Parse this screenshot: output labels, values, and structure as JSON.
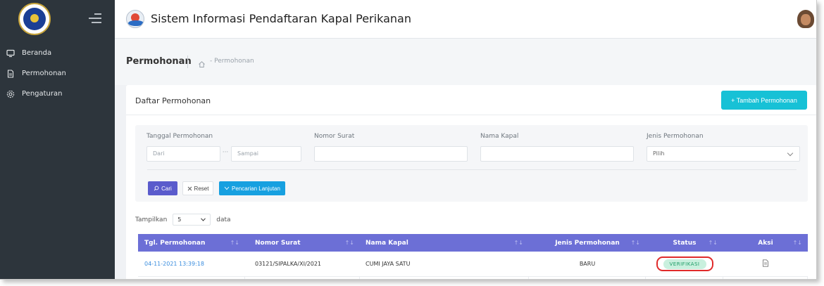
{
  "app": {
    "title": "Sistem Informasi Pendaftaran Kapal Perikanan"
  },
  "sidebar": {
    "items": [
      {
        "label": "Beranda",
        "icon": "monitor-icon"
      },
      {
        "label": "Permohonan",
        "icon": "document-icon"
      },
      {
        "label": "Pengaturan",
        "icon": "gear-icon"
      }
    ]
  },
  "breadcrumb": {
    "title": "Permohonan",
    "path": "- Permohonan"
  },
  "card": {
    "title": "Daftar Permohonan",
    "add_button": "+ Tambah Permohonan"
  },
  "filters": {
    "tanggal_label": "Tanggal Permohonan",
    "dari_placeholder": "Dari",
    "sampai_placeholder": "Sampai",
    "dots": "···",
    "nomor_label": "Nomor Surat",
    "nama_label": "Nama Kapal",
    "jenis_label": "Jenis Permohonan",
    "jenis_selected": "Pilih",
    "cari_button": "Cari",
    "reset_button": "Reset",
    "advanced_button": "Pencarian Lanjutan"
  },
  "pagination": {
    "show_label": "Tampilkan",
    "show_value": "5",
    "data_label": "data"
  },
  "table": {
    "columns": [
      "Tgl. Permohonan",
      "Nomor Surat",
      "Nama Kapal",
      "Jenis Permohonan",
      "Status",
      "Aksi"
    ],
    "sort_glyph": "↑↓",
    "rows": [
      {
        "tgl": "04-11-2021 13:39:18",
        "nomor": "03121/SIPALKA/XI/2021",
        "nama": "CUMI JAYA SATU",
        "jenis": "BARU",
        "status": "VERIFIKASI"
      }
    ]
  },
  "colors": {
    "sidebar": "#2d353c",
    "accent": "#17c1d6",
    "table_header": "#6c6fd6",
    "status_badge": "#c9f0de",
    "highlight": "#e02a2a"
  }
}
